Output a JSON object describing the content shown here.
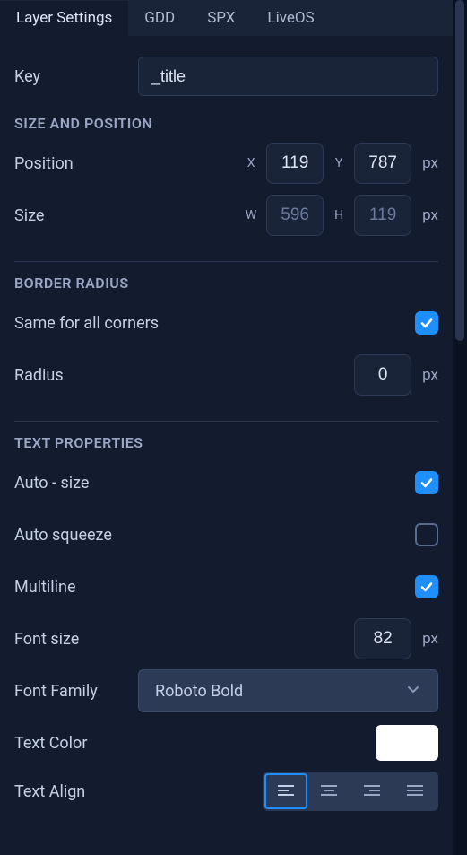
{
  "tabs": {
    "layer_settings": "Layer Settings",
    "gdd": "GDD",
    "spx": "SPX",
    "liveos": "LiveOS"
  },
  "key": {
    "label": "Key",
    "value": "_title"
  },
  "size_position": {
    "title": "SIZE AND POSITION",
    "position_label": "Position",
    "x_label": "X",
    "x_value": "119",
    "y_label": "Y",
    "y_value": "787",
    "size_label": "Size",
    "w_label": "W",
    "w_value": "596",
    "h_label": "H",
    "h_value": "119",
    "unit": "px"
  },
  "border_radius": {
    "title": "BORDER RADIUS",
    "same_label": "Same for all corners",
    "same_checked": true,
    "radius_label": "Radius",
    "radius_value": "0",
    "unit": "px"
  },
  "text_props": {
    "title": "TEXT PROPERTIES",
    "autosize_label": "Auto - size",
    "autosize_checked": true,
    "autosqueeze_label": "Auto squeeze",
    "autosqueeze_checked": false,
    "multiline_label": "Multiline",
    "multiline_checked": true,
    "fontsize_label": "Font size",
    "fontsize_value": "82",
    "unit": "px",
    "fontfamily_label": "Font Family",
    "fontfamily_value": "Roboto Bold",
    "textcolor_label": "Text Color",
    "textcolor_value": "#ffffff",
    "textalign_label": "Text Align",
    "textalign_value": "left"
  }
}
